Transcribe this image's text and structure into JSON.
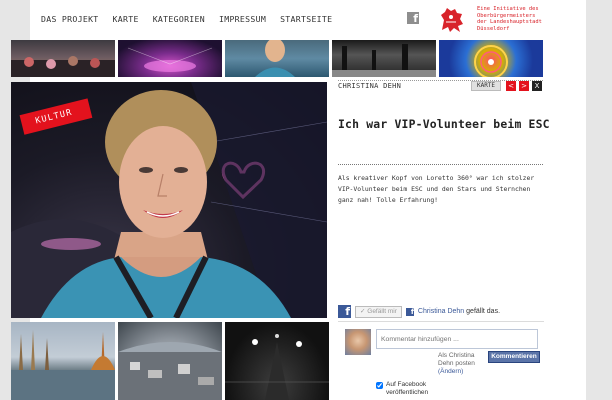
{
  "nav": {
    "items": [
      "DAS PROJEKT",
      "KARTE",
      "KATEGORIEN",
      "IMPRESSUM",
      "STARTSEITE"
    ]
  },
  "header": {
    "logo_text_lines": [
      "Eine Initiative des",
      "Oberbürgermeisters",
      "der Landeshauptstadt",
      "Düsseldorf"
    ],
    "facebook_letter": "f"
  },
  "article": {
    "category_badge": "KULTUR",
    "author": "CHRISTINA DEHN",
    "karte_button": "KARTE",
    "prev_arrow": "<",
    "next_arrow": ">",
    "close": "X",
    "title": "Ich war VIP-Volunteer beim ESC",
    "body": "Als kreativer Kopf von Loretto 360° war ich stolzer VIP-Volunteer beim ESC und den Stars und Sternchen ganz nah! Tolle Erfahrung!"
  },
  "facebook": {
    "like_button": "Gefällt mir",
    "liker_name": "Christina Dehn",
    "liked_suffix": "gefällt das.",
    "comment_placeholder": "Kommentar hinzufügen ...",
    "post_as_line1": "Als Christina",
    "post_as_line2": "Dehn posten",
    "change_link": "(Ändern)",
    "comment_button": "Kommentieren",
    "post_to_fb_line1": "Auf Facebook",
    "post_to_fb_line2": "veröffentlichen",
    "post_to_fb_checked": true
  },
  "colors": {
    "accent_red": "#e3121d",
    "facebook_blue": "#3b5998"
  }
}
